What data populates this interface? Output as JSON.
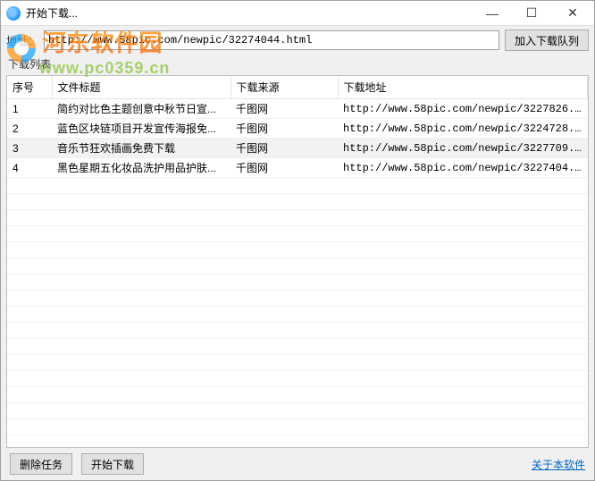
{
  "window": {
    "title": "开始下载..."
  },
  "address": {
    "label": "地址：",
    "value": "http://www.58pic.com/newpic/32274044.html"
  },
  "buttons": {
    "add_queue": "加入下载队列",
    "delete_task": "删除任务",
    "start_download": "开始下载"
  },
  "section": {
    "list_label": "下载列表"
  },
  "table": {
    "headers": {
      "seq": "序号",
      "title": "文件标题",
      "source": "下载来源",
      "url": "下载地址"
    },
    "rows": [
      {
        "seq": "1",
        "title": "简约对比色主题创意中秋节日宣...",
        "source": "千图网",
        "url": "http://www.58pic.com/newpic/3227826..."
      },
      {
        "seq": "2",
        "title": "蓝色区块链项目开发宣传海报免...",
        "source": "千图网",
        "url": "http://www.58pic.com/newpic/3224728..."
      },
      {
        "seq": "3",
        "title": "音乐节狂欢插画免费下载",
        "source": "千图网",
        "url": "http://www.58pic.com/newpic/3227709..."
      },
      {
        "seq": "4",
        "title": "黑色星期五化妆品洗护用品护肤...",
        "source": "千图网",
        "url": "http://www.58pic.com/newpic/3227404..."
      }
    ]
  },
  "footer": {
    "about": "关于本软件"
  },
  "watermark": {
    "main": "河东软件园",
    "sub": "www.pc0359.cn"
  }
}
